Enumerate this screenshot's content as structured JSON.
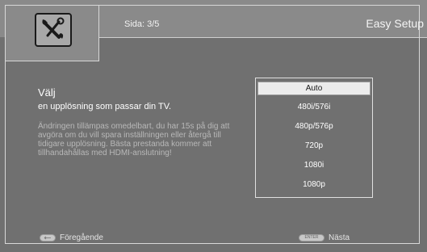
{
  "header": {
    "page_indicator": "Sida: 3/5",
    "title": "Easy Setup",
    "icon": "wrench-icon"
  },
  "main": {
    "heading": "Välj",
    "subheading": "en upplösning som passar din TV.",
    "description": "Ändringen tillämpas omedelbart, du har 15s på dig att avgöra om du vill spara inställningen eller återgå till tidigare upplösning. Bästa prestanda kommer att tillhandahållas med HDMI-anslutning!"
  },
  "resolutions": {
    "selected": "Auto",
    "options": [
      "Auto",
      "480i/576i",
      "480p/576p",
      "720p",
      "1080i",
      "1080p"
    ]
  },
  "footer": {
    "back_key": "back-key-icon",
    "back_label": "Föregående",
    "enter_key": "ENTER",
    "next_label": "Nästa"
  },
  "colors": {
    "background": "#707070",
    "header": "#8a8a8a",
    "selection": "#ececec"
  }
}
